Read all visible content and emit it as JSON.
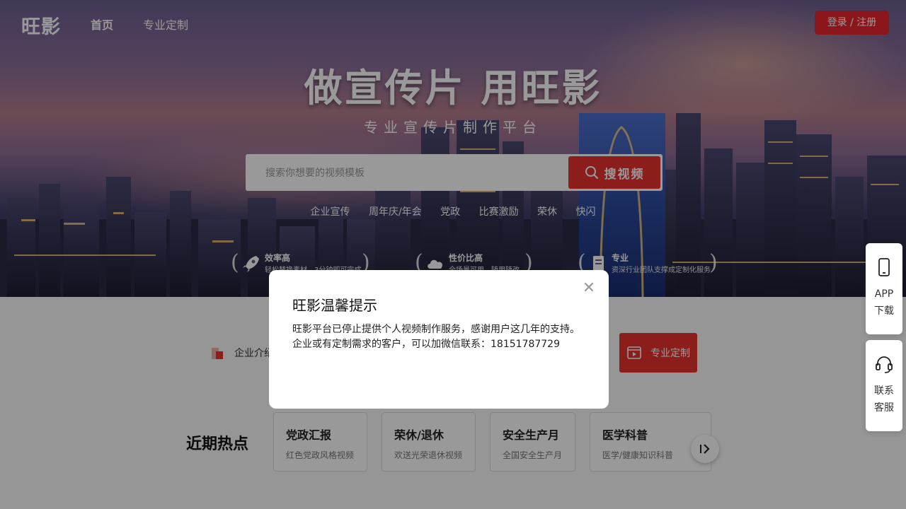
{
  "nav": {
    "logo": "旺影",
    "links": [
      "首页",
      "专业定制"
    ],
    "login_label": "登录 / 注册"
  },
  "hero": {
    "headline": "做宣传片 用旺影",
    "subline": "专业宣传片制作平台",
    "search_placeholder": "搜索你想要的视频模板",
    "search_button": "搜视频",
    "tags": [
      "企业宣传",
      "周年庆/年会",
      "党政",
      "比赛激励",
      "荣休",
      "快闪"
    ],
    "features": [
      {
        "title": "效率高",
        "desc": "轻松替换素材，3分钟即可完成",
        "icon": "rocket-icon"
      },
      {
        "title": "性价比高",
        "desc": "全场景可用，随用随改",
        "icon": "cloud-icon"
      },
      {
        "title": "专业",
        "desc": "资深行业团队支撑成定制化服务",
        "icon": "document-icon"
      }
    ]
  },
  "categories": {
    "first_label": "企业介绍",
    "custom_label": "专业定制"
  },
  "hot": {
    "title": "近期热点",
    "cards": [
      {
        "title": "党政汇报",
        "desc": "红色党政风格视频"
      },
      {
        "title": "荣休/退休",
        "desc": "欢送光荣退休视频"
      },
      {
        "title": "安全生产月",
        "desc": "全国安全生产月"
      },
      {
        "title": "医学科普",
        "desc": "医学/健康知识科普"
      }
    ]
  },
  "side": {
    "app_label_1": "APP",
    "app_label_2": "下载",
    "service_label_1": "联系",
    "service_label_2": "客服"
  },
  "modal": {
    "title": "旺影温馨提示",
    "line1": "旺影平台已停止提供个人视频制作服务，感谢用户这几年的支持。",
    "line2": "企业或有定制需求的客户，可以加微信联系：18151787729"
  },
  "colors": {
    "accent": "#e8332d",
    "overlay": "rgba(0,0,0,0.4)"
  }
}
